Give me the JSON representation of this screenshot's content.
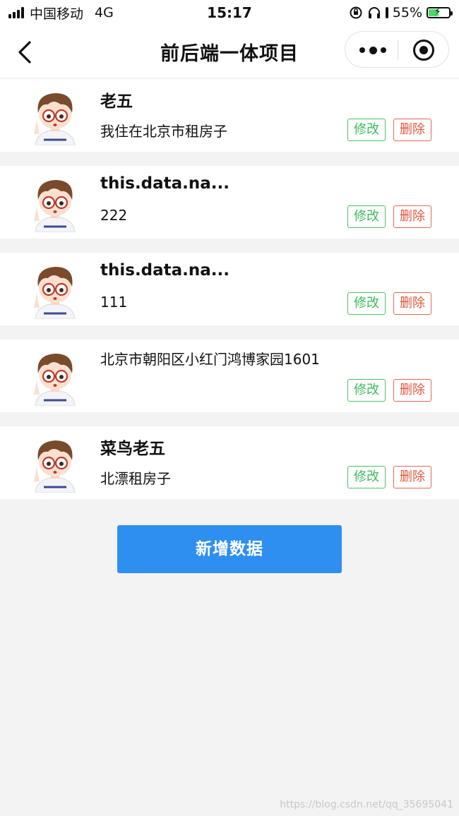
{
  "status_bar": {
    "carrier": "中国移动",
    "network": "4G",
    "time": "15:17",
    "battery": "55%",
    "battery_level": 0.55
  },
  "nav": {
    "title": "前后端一体项目"
  },
  "items": [
    {
      "name": "老五",
      "address": "我住在北京市租房子",
      "edit_label": "修改",
      "delete_label": "删除"
    },
    {
      "name": "this.data.na...",
      "address": "222",
      "edit_label": "修改",
      "delete_label": "删除"
    },
    {
      "name": "this.data.na...",
      "address": "111",
      "edit_label": "修改",
      "delete_label": "删除"
    },
    {
      "name": "",
      "address": "北京市朝阳区小红门鸿博家园1601",
      "edit_label": "修改",
      "delete_label": "删除"
    },
    {
      "name": "菜鸟老五",
      "address": "北漂租房子",
      "edit_label": "修改",
      "delete_label": "删除"
    }
  ],
  "add_button_label": "新增数据",
  "watermark": "https://blog.csdn.net/qq_35695041",
  "colors": {
    "edit": "#3dba5c",
    "delete": "#e0583c",
    "primary": "#2f8ff0"
  }
}
